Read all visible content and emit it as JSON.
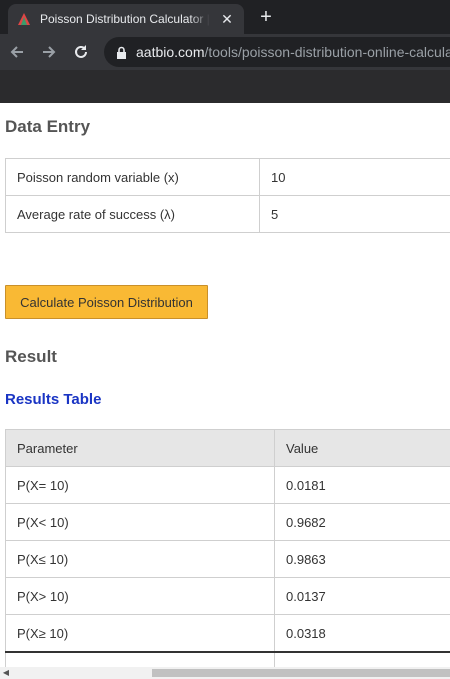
{
  "browser": {
    "tab_title": "Poisson Distribution Calculator | AAT Bioquest",
    "tab_close": "✕",
    "new_tab": "+",
    "url_host": "aatbio.com",
    "url_path": "/tools/poisson-distribution-online-calculator"
  },
  "data_entry": {
    "heading": "Data Entry",
    "rows": [
      {
        "label": "Poisson random variable (x)",
        "value": "10"
      },
      {
        "label": "Average rate of success (λ)",
        "value": "5"
      }
    ]
  },
  "calculate_button": "Calculate Poisson Distribution",
  "result": {
    "heading": "Result",
    "table_heading": "Results Table",
    "columns": [
      "Parameter",
      "Value"
    ],
    "rows": [
      {
        "parameter": "P(X= 10)",
        "value": "0.0181"
      },
      {
        "parameter": "P(X< 10)",
        "value": "0.9682"
      },
      {
        "parameter": "P(X≤ 10)",
        "value": "0.9863"
      },
      {
        "parameter": "P(X> 10)",
        "value": "0.0137"
      },
      {
        "parameter": "P(X≥ 10)",
        "value": "0.0318"
      }
    ]
  },
  "scrollbar": {
    "left_arrow": "◀"
  },
  "colors": {
    "button": "#f9b934",
    "link_heading": "#1a35c4",
    "table_header_bg": "#e6e6e6"
  }
}
